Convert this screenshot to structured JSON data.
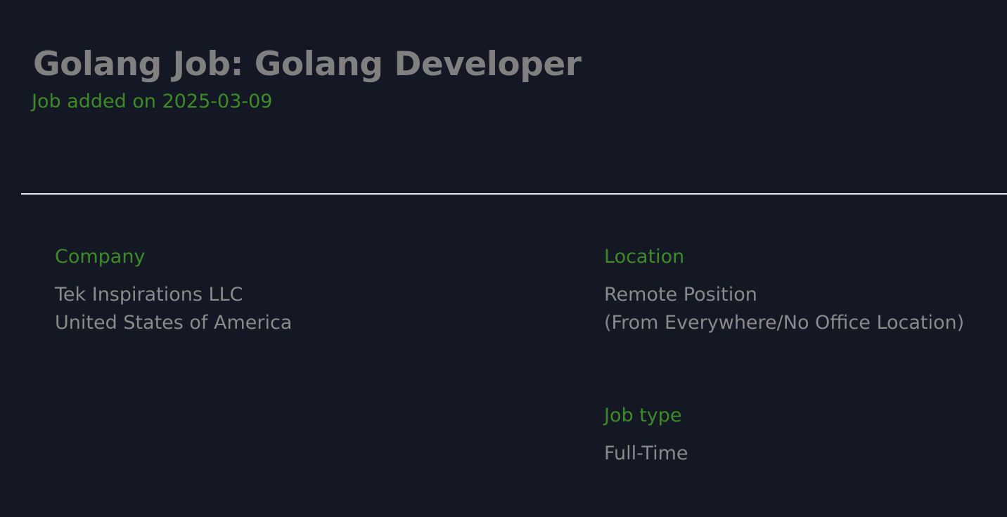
{
  "header": {
    "title": "Golang Job: Golang Developer",
    "added_on": "Job added on 2025-03-09"
  },
  "details": {
    "company": {
      "label": "Company",
      "name": "Tek Inspirations LLC",
      "country": "United States of America"
    },
    "location": {
      "label": "Location",
      "line1": "Remote Position",
      "line2": "(From Everywhere/No Office Location)"
    },
    "job_type": {
      "label": "Job type",
      "value": "Full-Time"
    }
  },
  "colors": {
    "background": "#141724",
    "accent_green": "#3d8b26",
    "title_gray": "#808080",
    "text_gray": "#8a8a8a",
    "divider": "#e8e8e8"
  }
}
